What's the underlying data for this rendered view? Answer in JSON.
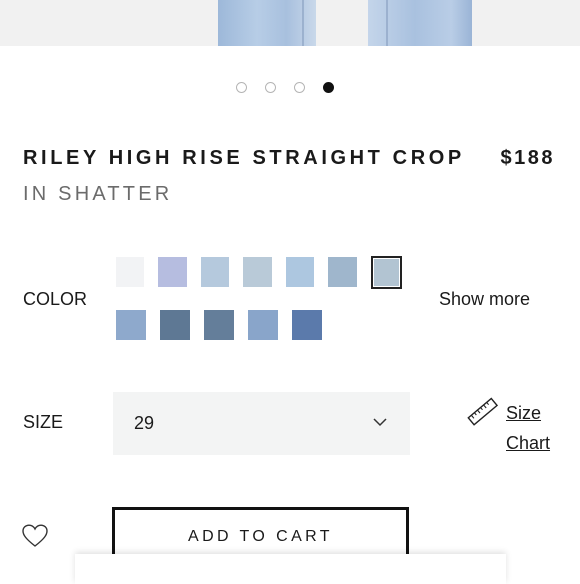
{
  "carousel": {
    "total": 4,
    "active_index": 3
  },
  "product": {
    "title": "RILEY HIGH RISE STRAIGHT CROP",
    "price": "$188",
    "color_name": "IN SHATTER"
  },
  "color": {
    "label": "COLOR",
    "show_more": "Show more",
    "swatches_row1": [
      "#f2f3f5",
      "#b6bde0",
      "#b5c9dd",
      "#b9cad8",
      "#adc7e0",
      "#9fb6cc",
      "#b2c4d2"
    ],
    "swatches_row2": [
      "#8ea9cc",
      "#5e7894",
      "#647e9a",
      "#89a5ca",
      "#5b7aab"
    ],
    "selected_index": 6
  },
  "size": {
    "label": "SIZE",
    "selected": "29",
    "size_chart_label": "Size Chart"
  },
  "actions": {
    "add_to_cart": "ADD TO CART"
  },
  "icons": {
    "wishlist": "heart-icon",
    "size_chart": "ruler-icon",
    "dropdown": "chevron-down-icon"
  }
}
